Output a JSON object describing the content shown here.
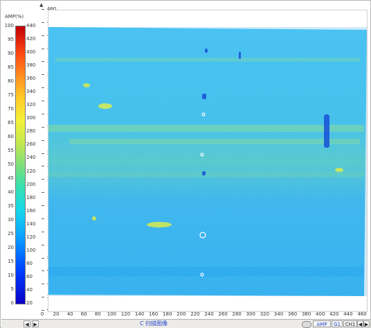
{
  "legend": {
    "header": "AMP(%)",
    "left_ticks": [
      "100",
      "95",
      "90",
      "85",
      "80",
      "75",
      "70",
      "65",
      "60",
      "55",
      "50",
      "45",
      "40",
      "35",
      "30",
      "25",
      "20",
      "15",
      "10",
      "5",
      "0"
    ],
    "right_ticks": [
      "440",
      "420",
      "400",
      "380",
      "360",
      "340",
      "320",
      "300",
      "280",
      "260",
      "240",
      "220",
      "200",
      "180",
      "160",
      "140",
      "120",
      "100",
      "80",
      "60",
      "40",
      "20"
    ]
  },
  "y_axis": {
    "ticks": [
      "460",
      "440",
      "420",
      "400",
      "380",
      "360",
      "340",
      "320",
      "300",
      "280",
      "260",
      "240",
      "220",
      "200",
      "180",
      "160",
      "140",
      "120",
      "100",
      "80",
      "60",
      "40",
      "20",
      "0"
    ],
    "up_arrow": "▲"
  },
  "x_axis": {
    "ticks": [
      "0",
      "20",
      "40",
      "60",
      "80",
      "100",
      "120",
      "140",
      "160",
      "180",
      "200",
      "220",
      "240",
      "260",
      "280",
      "300",
      "320",
      "340",
      "360",
      "380",
      "400",
      "420",
      "440",
      "460"
    ]
  },
  "scan_image": {
    "base_color": "#3ec0f0",
    "stripe_color": "#7fdc9e",
    "defect_color": "#1a56d8"
  },
  "status_bar": {
    "scroll_left": "◀",
    "scroll_right": "▶",
    "title": "C 扫描图像",
    "amp_button": "AMP",
    "gate_button": "G1",
    "channel_button": "CH1",
    "prev": "◀",
    "next": "▶"
  }
}
